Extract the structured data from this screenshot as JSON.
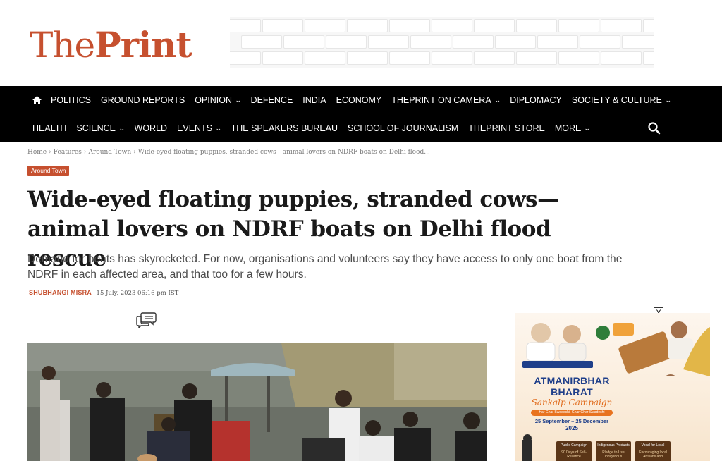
{
  "header": {
    "logo_the": "The",
    "logo_print": "Print"
  },
  "nav": {
    "row1": [
      {
        "label": "POLITICS",
        "dropdown": false
      },
      {
        "label": "GROUND REPORTS",
        "dropdown": false
      },
      {
        "label": "OPINION",
        "dropdown": true
      },
      {
        "label": "DEFENCE",
        "dropdown": false
      },
      {
        "label": "INDIA",
        "dropdown": false
      },
      {
        "label": "ECONOMY",
        "dropdown": false
      },
      {
        "label": "THEPRINT ON CAMERA",
        "dropdown": true
      },
      {
        "label": "DIPLOMACY",
        "dropdown": false
      },
      {
        "label": "SOCIETY & CULTURE",
        "dropdown": true
      }
    ],
    "row2": [
      {
        "label": "HEALTH",
        "dropdown": false
      },
      {
        "label": "SCIENCE",
        "dropdown": true
      },
      {
        "label": "WORLD",
        "dropdown": false
      },
      {
        "label": "EVENTS",
        "dropdown": true
      },
      {
        "label": "THE SPEAKERS BUREAU",
        "dropdown": false
      },
      {
        "label": "SCHOOL OF JOURNALISM",
        "dropdown": false
      },
      {
        "label": "THEPRINT STORE",
        "dropdown": false
      },
      {
        "label": "MORE",
        "dropdown": true
      }
    ],
    "chevron": "⌄",
    "search_icon": "search-icon",
    "home_icon": "home-icon"
  },
  "breadcrumb": {
    "home": "Home",
    "features": "Features",
    "around_town": "Around Town",
    "current": "Wide-eyed floating puppies, stranded cows—animal lovers on NDRF boats on Delhi flood...",
    "separator": "›"
  },
  "article": {
    "tag": "Around Town",
    "headline": "Wide-eyed floating puppies, stranded cows—animal lovers on NDRF boats on Delhi flood rescue",
    "standfirst": "Demand for boats has skyrocketed. For now, organisations and volunteers say they have access to only one boat from the NDRF in each affected area, and that too for a few hours.",
    "author": "SHUBHANGI MISRA",
    "date": "15 July, 2023 06:16 pm IST"
  },
  "side_ad": {
    "close": "X",
    "info": "i",
    "title_line1": "ATMANIRBHAR",
    "title_line2": "BHARAT",
    "campaign": "Sankalp Campaign",
    "tagline": "Har Ghar Swadeshi, Ghar Ghar Swadeshi",
    "dates": "25 September – 25 December",
    "year": "2025",
    "boxes": [
      {
        "title": "Public Campaign",
        "sub": "90 Days of Self-Reliance"
      },
      {
        "title": "Indigenous Products",
        "sub": "Pledge to Use Indigenous"
      },
      {
        "title": "Vocal for Local",
        "sub": "Encouraging local Artisans and"
      }
    ]
  },
  "colors": {
    "brand": "#c6502f",
    "nav_bg": "#000000",
    "ad_blue": "#1f3f8a",
    "ad_orange": "#e06a1a"
  }
}
